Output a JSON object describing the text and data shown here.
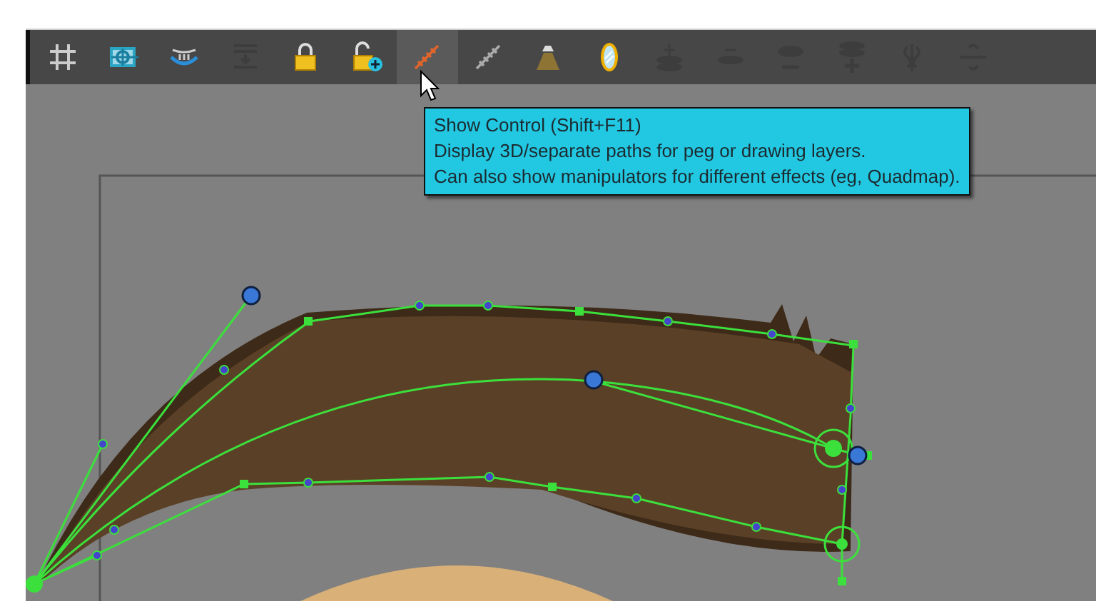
{
  "toolbar": {
    "buttons": [
      {
        "kind": "grid",
        "selected": false,
        "disabled": false
      },
      {
        "kind": "target",
        "selected": false,
        "disabled": false
      },
      {
        "kind": "onion",
        "selected": false,
        "disabled": false
      },
      {
        "kind": "flatten",
        "selected": false,
        "disabled": true
      },
      {
        "kind": "lock",
        "selected": false,
        "disabled": false
      },
      {
        "kind": "unlock",
        "selected": false,
        "disabled": false
      },
      {
        "kind": "path",
        "selected": true,
        "disabled": false
      },
      {
        "kind": "path",
        "selected": false,
        "disabled": false
      },
      {
        "kind": "lamp",
        "selected": false,
        "disabled": false
      },
      {
        "kind": "mirror",
        "selected": false,
        "disabled": false
      },
      {
        "kind": "stackplus",
        "selected": false,
        "disabled": true
      },
      {
        "kind": "stackminus",
        "selected": false,
        "disabled": true
      },
      {
        "kind": "stackminusb",
        "selected": false,
        "disabled": true
      },
      {
        "kind": "stackplusb",
        "selected": false,
        "disabled": true
      },
      {
        "kind": "curvev",
        "selected": false,
        "disabled": true
      },
      {
        "kind": "curveh",
        "selected": false,
        "disabled": true
      }
    ]
  },
  "tooltip": {
    "title": "Show Control (Shift+F11)",
    "lines": [
      "Display 3D/separate paths for peg or drawing layers.",
      "Can also show manipulators for different effects (eg, Quadmap)."
    ]
  }
}
